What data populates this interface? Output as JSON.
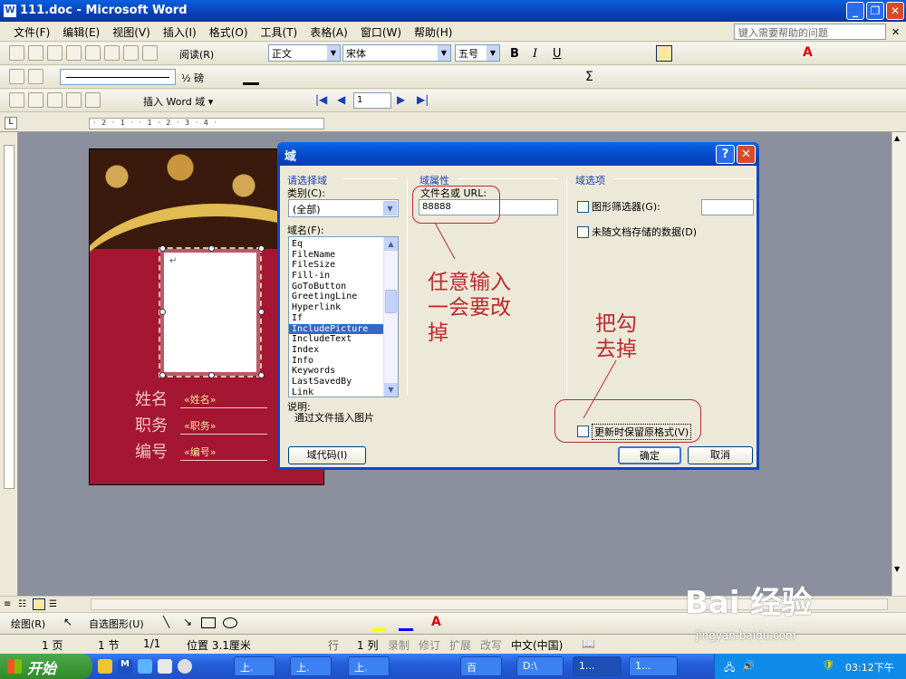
{
  "window": {
    "title": "111.doc - Microsoft Word"
  },
  "menubar": {
    "items": [
      "文件(F)",
      "编辑(E)",
      "视图(V)",
      "插入(I)",
      "格式(O)",
      "工具(T)",
      "表格(A)",
      "窗口(W)",
      "帮助(H)"
    ],
    "help_placeholder": "键入需要帮助的问题"
  },
  "toolbar": {
    "read_label": "阅读(R)",
    "style_value": "正文",
    "font_value": "宋体",
    "size_value": "五号",
    "bold": "B",
    "italic": "I",
    "underline": "U",
    "line_weight": "½ 磅",
    "insert_word_field": "插入 Word 域 ▾",
    "record_number": "1"
  },
  "ruler": {
    "marks": "· 2 · 1 ·  · 1 · 2 · 3 · 4 ·"
  },
  "card": {
    "name_label": "姓名",
    "name_field": "«姓名»",
    "title_label": "职务",
    "title_field": "«职务»",
    "id_label": "编号",
    "id_field": "«编号»",
    "return_mark": "↵"
  },
  "dialog": {
    "title": "域",
    "help": "?",
    "close": "✕",
    "choose_field_header": "请选择域",
    "category_label": "类别(C):",
    "category_value": "(全部)",
    "field_names_label": "域名(F):",
    "field_names": [
      "Eq",
      "FileName",
      "FileSize",
      "Fill-in",
      "GoToButton",
      "GreetingLine",
      "Hyperlink",
      "If",
      "IncludePicture",
      "IncludeText",
      "Index",
      "Info",
      "Keywords",
      "LastSavedBy",
      "Link"
    ],
    "selected_field": "IncludePicture",
    "description_label": "说明:",
    "description_text": "通过文件插入图片",
    "field_properties_header": "域属性",
    "filename_label": "文件名或 URL:",
    "filename_value": "88888",
    "field_options_header": "域选项",
    "graphic_filter_label": "图形筛选器(G):",
    "not_stored_label": "未随文档存储的数据(D)",
    "preserve_format_label": "更新时保留原格式(V)",
    "field_codes_button": "域代码(I)",
    "ok_button": "确定",
    "cancel_button": "取消"
  },
  "annotations": {
    "input_note": [
      "任意输入",
      "一会要改",
      "掉"
    ],
    "uncheck_note": [
      "把勾",
      "去掉"
    ]
  },
  "drawing_toolbar": {
    "draw_label": "绘图(R)",
    "autoshapes_label": "自选图形(U)"
  },
  "statusbar": {
    "page": "1 页",
    "section": "1 节",
    "pages": "1/1",
    "position": "位置 3.1厘米",
    "line": "行",
    "column": "1 列",
    "rec": "录制",
    "trk": "修订",
    "ext": "扩展",
    "ovr": "改写",
    "language": "中文(中国)"
  },
  "taskbar": {
    "start": "开始",
    "items": [
      "上.",
      "上.",
      "上.",
      "百",
      "D:\\",
      "1...",
      "1..."
    ],
    "clock": "03:12下午"
  },
  "watermark": {
    "brand": "Bai 经验",
    "url": "jingyan.baidu.com"
  }
}
